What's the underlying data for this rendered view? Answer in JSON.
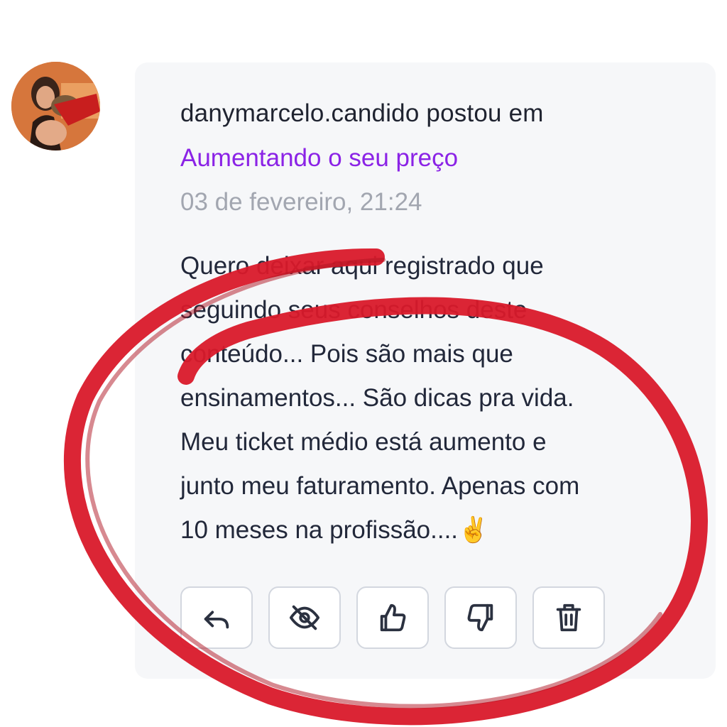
{
  "post": {
    "author_line": "danymarcelo.candido postou em",
    "topic": "Aumentando o seu preço",
    "timestamp": "03 de fevereiro, 21:24",
    "body_lines": [
      "Quero deixar aqui registrado que",
      "seguindo seus conselhos deste",
      "conteúdo... Pois são mais que",
      "ensinamentos... São dicas pra vida.",
      "Meu ticket médio está aumento e",
      "junto meu faturamento. Apenas com",
      "10 meses na profissão....✌️"
    ]
  },
  "actions": [
    {
      "name": "reply-button",
      "icon": "reply-arrow-icon"
    },
    {
      "name": "hide-button",
      "icon": "eye-off-icon"
    },
    {
      "name": "like-button",
      "icon": "thumbs-up-icon"
    },
    {
      "name": "dislike-button",
      "icon": "thumbs-down-icon"
    },
    {
      "name": "delete-button",
      "icon": "trash-icon"
    }
  ],
  "colors": {
    "topic_link": "#8b23e6",
    "timestamp": "#a2a6b0",
    "card_background": "#f6f7f9",
    "highlight_circle": "#d9192a"
  }
}
